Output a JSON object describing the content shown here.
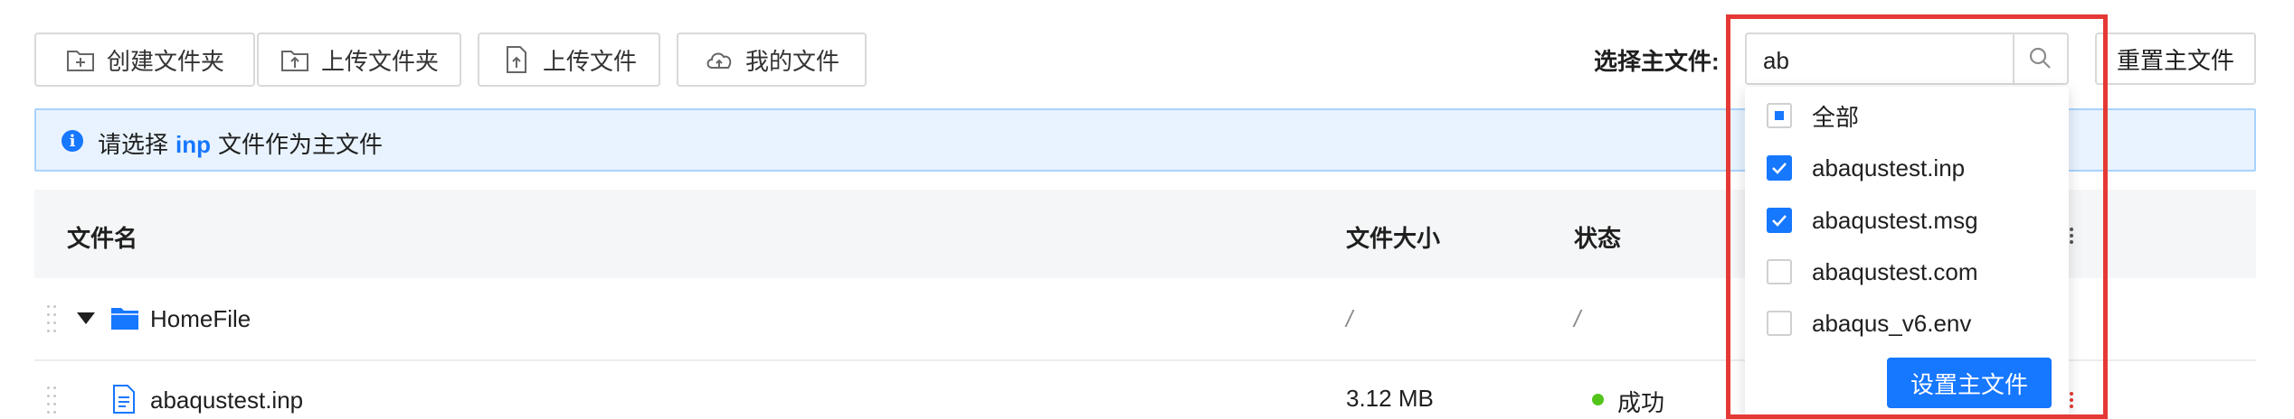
{
  "toolbar": {
    "create_folder": "创建文件夹",
    "upload_folder": "上传文件夹",
    "upload_file": "上传文件",
    "my_files": "我的文件"
  },
  "main_file": {
    "label": "选择主文件:",
    "search_value": "ab",
    "reset_label": "重置主文件"
  },
  "info": {
    "prefix": "请选择",
    "ext": "inp",
    "suffix": "文件作为主文件"
  },
  "table": {
    "headers": {
      "name": "文件名",
      "size": "文件大小",
      "status": "状态"
    },
    "rows": [
      {
        "name": "HomeFile",
        "size": "/",
        "status": "/",
        "type": "folder"
      },
      {
        "name": "abaqustest.inp",
        "size": "3.12 MB",
        "status": "成功",
        "type": "file"
      }
    ]
  },
  "dropdown": {
    "options": [
      {
        "label": "全部",
        "state": "indeterminate"
      },
      {
        "label": "abaqustest.inp",
        "state": "checked"
      },
      {
        "label": "abaqustest.msg",
        "state": "checked"
      },
      {
        "label": "abaqustest.com",
        "state": "unchecked"
      },
      {
        "label": "abaqus_v6.env",
        "state": "unchecked"
      }
    ],
    "confirm_label": "设置主文件"
  },
  "colors": {
    "accent": "#1677ff",
    "success": "#52c41a",
    "highlight": "#e53935",
    "info_bg": "#e8f3ff"
  },
  "icons": [
    "folder-plus-icon",
    "folder-upload-icon",
    "file-upload-icon",
    "cloud-upload-icon",
    "search-icon",
    "info-icon",
    "caret-down-icon",
    "folder-icon",
    "file-icon",
    "drag-handle-icon",
    "more-icon"
  ]
}
